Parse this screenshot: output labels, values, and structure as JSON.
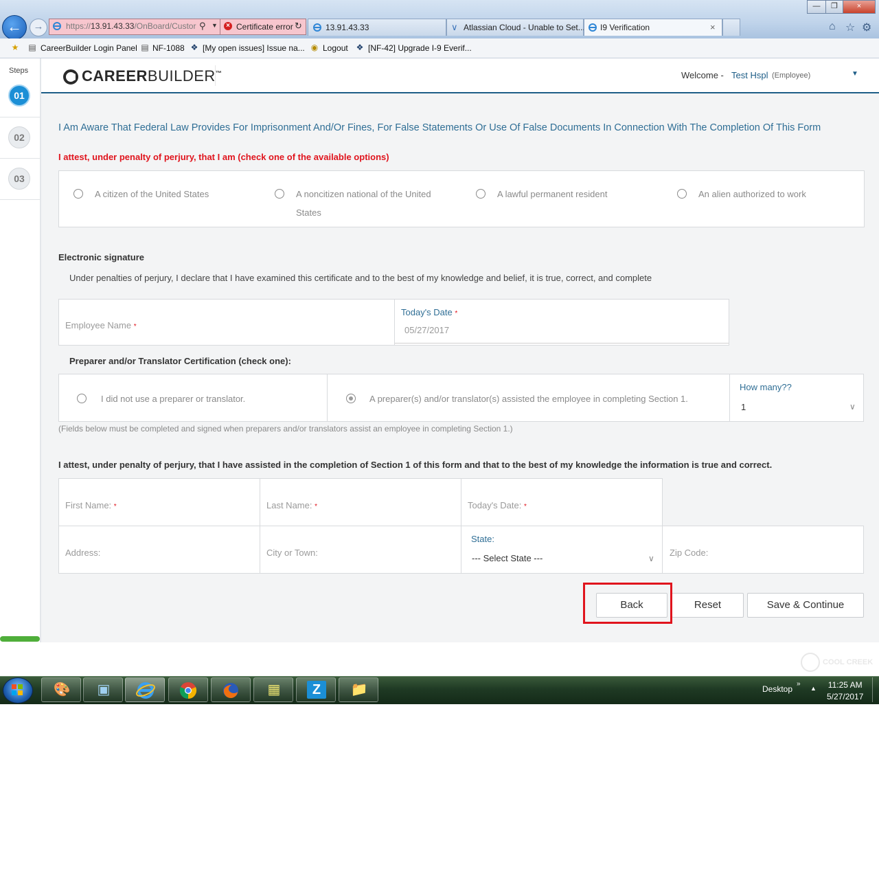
{
  "browser": {
    "address": {
      "scheme": "https://",
      "host": "13.91.43.33",
      "path": "/OnBoard/Custor"
    },
    "cert_error": "Certificate error",
    "tabs": [
      {
        "label": "13.91.43.33"
      },
      {
        "label": "Atlassian Cloud - Unable to Set..."
      },
      {
        "label": "I9 Verification",
        "active": true
      }
    ],
    "favorites": [
      {
        "label": "CareerBuilder Login Panel"
      },
      {
        "label": "NF-1088"
      },
      {
        "label": "[My open issues] Issue na..."
      },
      {
        "label": "Logout"
      },
      {
        "label": "[NF-42] Upgrade I-9 Everif..."
      }
    ]
  },
  "nav": {
    "steps_label": "Steps",
    "steps": [
      {
        "num": "01",
        "active": true
      },
      {
        "num": "02",
        "active": false
      },
      {
        "num": "03",
        "active": false
      }
    ]
  },
  "header": {
    "logo_bold": "CAREER",
    "logo_light": "BUILDER",
    "logo_tm": "™",
    "welcome": "Welcome -",
    "user_name": "Test Hspl",
    "user_role": "(Employee)"
  },
  "form": {
    "aware_text": "I Am Aware That Federal Law Provides For Imprisonment And/Or Fines, For False Statements Or Use Of False Documents In Connection With The Completion Of This Form",
    "attest_status_label": "I attest, under penalty of perjury, that I am (check one of the available options)",
    "status_options": [
      {
        "line1": "A citizen of the United States",
        "line2": ""
      },
      {
        "line1": "A noncitizen national of the United",
        "line2": "States"
      },
      {
        "line1": "A lawful permanent resident",
        "line2": ""
      },
      {
        "line1": "An alien authorized to work",
        "line2": ""
      }
    ],
    "esig_title": "Electronic signature",
    "esig_text": "Under penalties of perjury, I declare that I have examined this certificate and to the best of my knowledge and belief, it is true, correct, and complete",
    "employee_name_ph": "Employee Name",
    "todays_date_label": "Today's Date",
    "todays_date_value": "05/27/2017",
    "required_mark": "*",
    "prep_title": "Preparer and/or Translator Certification (check one):",
    "prep_opt1": "I did not use a preparer or translator.",
    "prep_opt2": "A preparer(s) and/or translator(s) assisted the employee in completing Section 1.",
    "how_many_label": "How many??",
    "how_many_value": "1",
    "note": "(Fields below must be completed and signed when preparers and/or translators assist an employee in completing Section 1.)",
    "attest_prep": "I attest, under penalty of perjury, that I have assisted in the completion of Section 1 of this form and that to the best of my knowledge the information is true and correct.",
    "first_name_ph": "First Name:",
    "last_name_ph": "Last Name:",
    "prep_date_ph": "Today's Date:",
    "address_ph": "Address:",
    "city_ph": "City or Town:",
    "state_label": "State:",
    "state_value": "--- Select State ---",
    "zip_ph": "Zip Code:"
  },
  "buttons": {
    "back": "Back",
    "reset": "Reset",
    "save": "Save & Continue"
  },
  "watermark": "COOL CREEK",
  "taskbar": {
    "desktop": "Desktop",
    "time": "11:25 AM",
    "date": "5/27/2017",
    "z_label": "Z"
  },
  "colors": {
    "accent": "#2f6e95",
    "required": "#e0141d",
    "step_active": "#1b8fd6",
    "highlight": "#e0141d"
  }
}
